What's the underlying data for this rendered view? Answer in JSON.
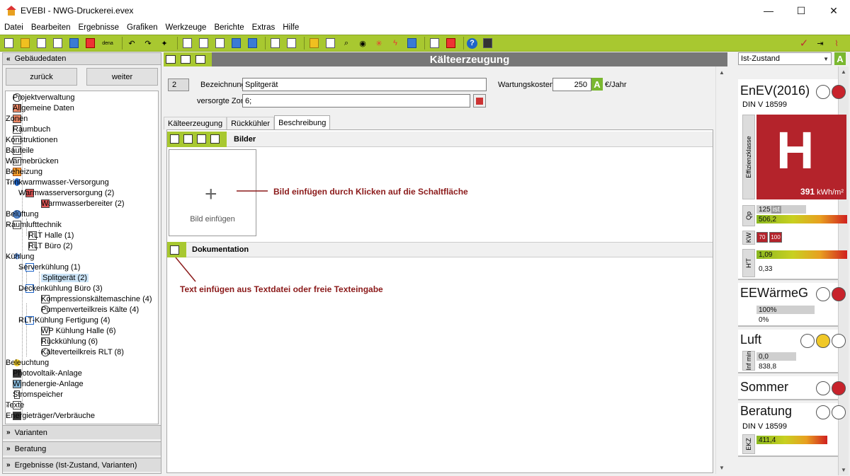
{
  "window": {
    "title": "EVEBI - NWG-Druckerei.evex",
    "controls": [
      "—",
      "☐",
      "✕"
    ]
  },
  "menu": [
    "Datei",
    "Bearbeiten",
    "Ergebnisse",
    "Grafiken",
    "Werkzeuge",
    "Berichte",
    "Extras",
    "Hilfe"
  ],
  "toolbar": {
    "dena_label": "dena"
  },
  "left": {
    "header": "Gebäudedaten",
    "back": "zurück",
    "forward": "weiter",
    "tree": [
      "Projektverwaltung",
      "Allgemeine Daten",
      "Zonen",
      "Raumbuch",
      "Konstruktionen",
      "Bauteile",
      "Wärmebrücken",
      "Beheizung",
      "Trinkwarmwasser-Versorgung",
      "Warmwasserversorgung (2)",
      "Warmwasserbereiter (2)",
      "Belüftung",
      "Raumlufttechnik",
      "RLT Halle (1)",
      "RLT Büro (2)",
      "Kühlung",
      "Serverkühlung (1)",
      "Splitgerät (2)",
      "Deckenkühlung Büro (3)",
      "Kompressionskältemaschine (4)",
      "Pumpenverteilkreis Kälte (4)",
      "RLT-Kühlung Fertigung (4)",
      "WP Kühlung Halle (6)",
      "Rückkühlung (6)",
      "Kälteverteilkreis RLT (8)",
      "Beleuchtung",
      "Photovoltaik-Anlage",
      "Windenergie-Anlage",
      "Stromspeicher",
      "Texte",
      "Energieträger/Verbräuche"
    ],
    "bottom": [
      "Varianten",
      "Beratung",
      "Ergebnisse (Ist-Zustand, Varianten)"
    ]
  },
  "center": {
    "title": "Kälteerzeugung",
    "number": "2",
    "bezeichnung_label": "Bezeichnung",
    "bezeichnung_value": "Splitgerät",
    "zonen_label": "versorgte Zonen",
    "zonen_value": "6;",
    "wartung_label": "Wartungskosten",
    "wartung_value": "250",
    "wartung_unit": "€/Jahr",
    "a_badge": "A",
    "tabs": [
      "Kälteerzeugung",
      "Rückkühler",
      "Beschreibung"
    ],
    "bilder_title": "Bilder",
    "bild_plus": "+",
    "bild_caption": "Bild einfügen",
    "bild_hint": "Bild einfügen durch Klicken auf die Schaltfläche",
    "doku_title": "Dokumentation",
    "doku_hint": "Text einfügen aus Textdatei oder freie Texteingabe"
  },
  "right": {
    "combo": "Ist-Zustand",
    "combo_badge": "A",
    "enev": {
      "title": "EnEV(2016)",
      "sub": "DIN V 18599",
      "class_label": "Effizienzklasse",
      "class_letter": "H",
      "value": "391",
      "unit": "kWh/m²",
      "qp_label": "Qp",
      "qp_ref": "125",
      "qp_ref_tag": "ist",
      "qp_val": "506,2",
      "kw_label": "KW",
      "kw1": "70",
      "kw2": "100",
      "ht_label": "H'T",
      "ht_val": "1,09",
      "ht_ref": "0,33",
      "status_colors": [
        "#ffffff",
        "#c8232c"
      ]
    },
    "eew": {
      "title": "EEWärmeG",
      "v1": "100%",
      "v2": "0%",
      "status_colors": [
        "#ffffff",
        "#c8232c"
      ]
    },
    "luft": {
      "title": "Luft",
      "label": "Inf min",
      "v1": "0,0",
      "v2": "838,8",
      "status_colors": [
        "#ffffff",
        "#f0c828",
        "#ffffff"
      ]
    },
    "sommer": {
      "title": "Sommer",
      "status_colors": [
        "#ffffff",
        "#c8232c"
      ]
    },
    "beratung": {
      "title": "Beratung",
      "sub": "DIN V 18599",
      "label": "EKZ",
      "value": "411,4",
      "status_colors": [
        "#ffffff",
        "#ffffff"
      ]
    }
  }
}
